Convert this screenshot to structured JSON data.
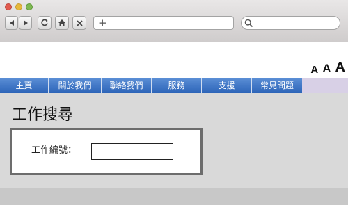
{
  "toolbar": {
    "new_tab_symbol": "+",
    "address_value": ""
  },
  "font_size_controls": [
    "A",
    "A",
    "A"
  ],
  "nav": {
    "items": [
      "主頁",
      "關於我們",
      "聯絡我們",
      "服務",
      "支援",
      "常見問題"
    ]
  },
  "page": {
    "title": "工作搜尋",
    "job_id_label": "工作編號：",
    "job_id_value": ""
  },
  "colors": {
    "nav_blue": "#2c64b8",
    "nav_tail": "#d8d0e6",
    "content_bg": "#d9d9d9"
  }
}
